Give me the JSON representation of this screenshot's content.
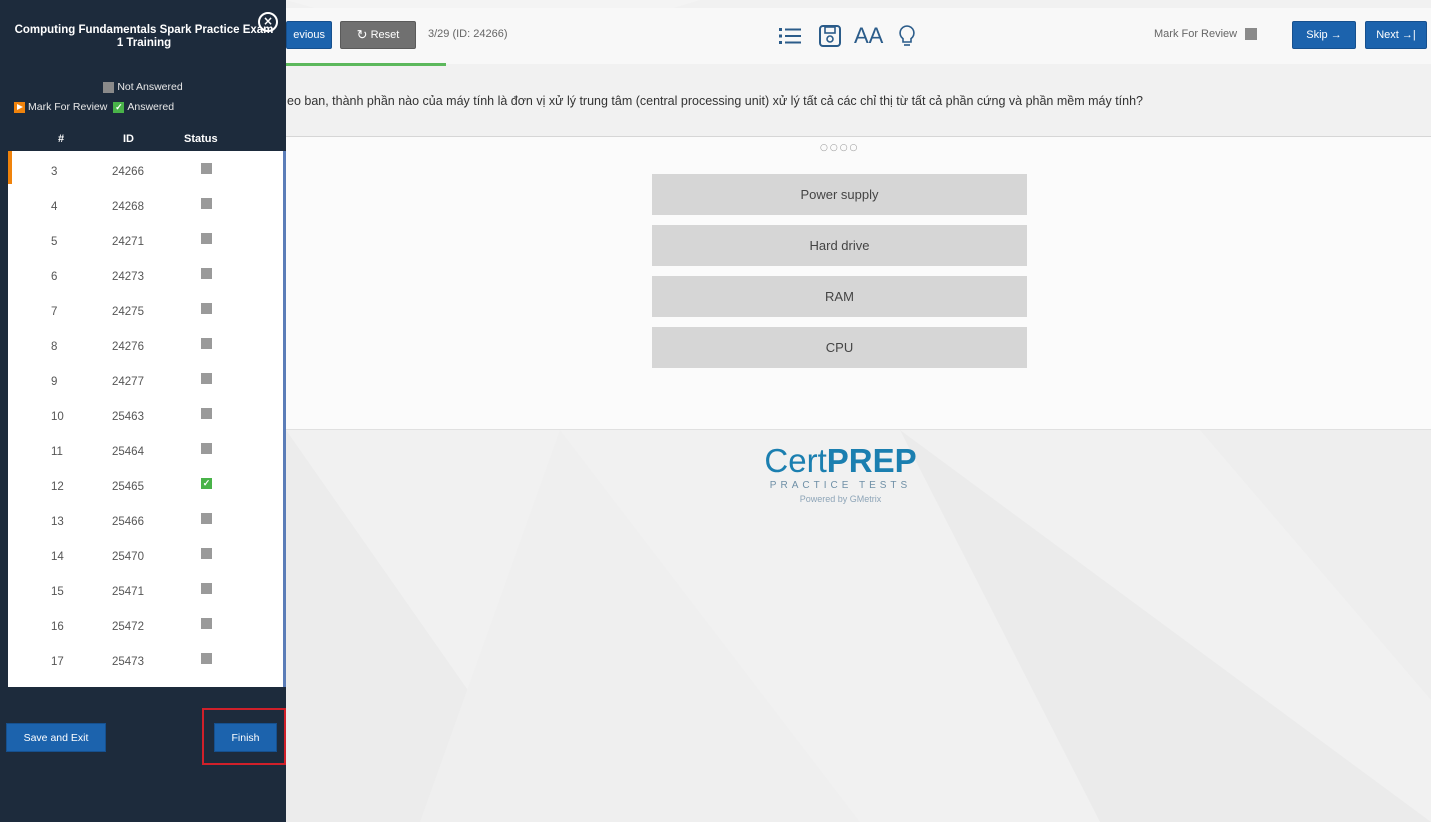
{
  "toolbar": {
    "previous_label": "evious",
    "reset_label": "Reset",
    "question_counter": "3/29 (ID: 24266)",
    "mark_for_review_label": "Mark For Review",
    "skip_label": "Skip →",
    "next_label": "Next →|",
    "font_size_icon_text": "AA",
    "icons": [
      "list-icon",
      "save-icon",
      "font-size-icon",
      "hint-icon"
    ],
    "progress_fraction": 0.103
  },
  "question": {
    "text": "eo ban, thành phần nào của máy tính là đơn vị xử lý trung tâm (central processing unit) xử lý tất cả các chỉ thị từ tất cả phần cứng và phần mềm máy tính?",
    "dots": "○○○○",
    "answers": [
      "Power supply",
      "Hard drive",
      "RAM",
      "CPU"
    ]
  },
  "logo": {
    "main_light": "Cert",
    "main_bold": "PREP",
    "sub": "PRACTICE TESTS",
    "powered": "Powered by GMetrix"
  },
  "sidebar": {
    "title": "Computing Fundamentals Spark Practice Exam 1 Training",
    "legend_not_answered": "Not Answered",
    "legend_mark_review": "Mark For Review",
    "legend_answered": "Answered",
    "headers": {
      "num": "#",
      "id": "ID",
      "status": "Status"
    },
    "rows": [
      {
        "num": "3",
        "id": "24266",
        "status": "not-answered"
      },
      {
        "num": "4",
        "id": "24268",
        "status": "not-answered"
      },
      {
        "num": "5",
        "id": "24271",
        "status": "not-answered"
      },
      {
        "num": "6",
        "id": "24273",
        "status": "not-answered"
      },
      {
        "num": "7",
        "id": "24275",
        "status": "not-answered"
      },
      {
        "num": "8",
        "id": "24276",
        "status": "not-answered"
      },
      {
        "num": "9",
        "id": "24277",
        "status": "not-answered"
      },
      {
        "num": "10",
        "id": "25463",
        "status": "not-answered"
      },
      {
        "num": "11",
        "id": "25464",
        "status": "not-answered"
      },
      {
        "num": "12",
        "id": "25465",
        "status": "answered"
      },
      {
        "num": "13",
        "id": "25466",
        "status": "not-answered"
      },
      {
        "num": "14",
        "id": "25470",
        "status": "not-answered"
      },
      {
        "num": "15",
        "id": "25471",
        "status": "not-answered"
      },
      {
        "num": "16",
        "id": "25472",
        "status": "not-answered"
      },
      {
        "num": "17",
        "id": "25473",
        "status": "not-answered"
      }
    ],
    "save_exit_label": "Save and Exit",
    "finish_label": "Finish"
  },
  "colors": {
    "sidebar_bg": "#1d2b3c",
    "button_blue": "#1c63ad",
    "answered_green": "#49b349",
    "review_orange": "#f0830c",
    "highlight_red": "#d0202a",
    "logo_blue": "#1b7fb0"
  }
}
